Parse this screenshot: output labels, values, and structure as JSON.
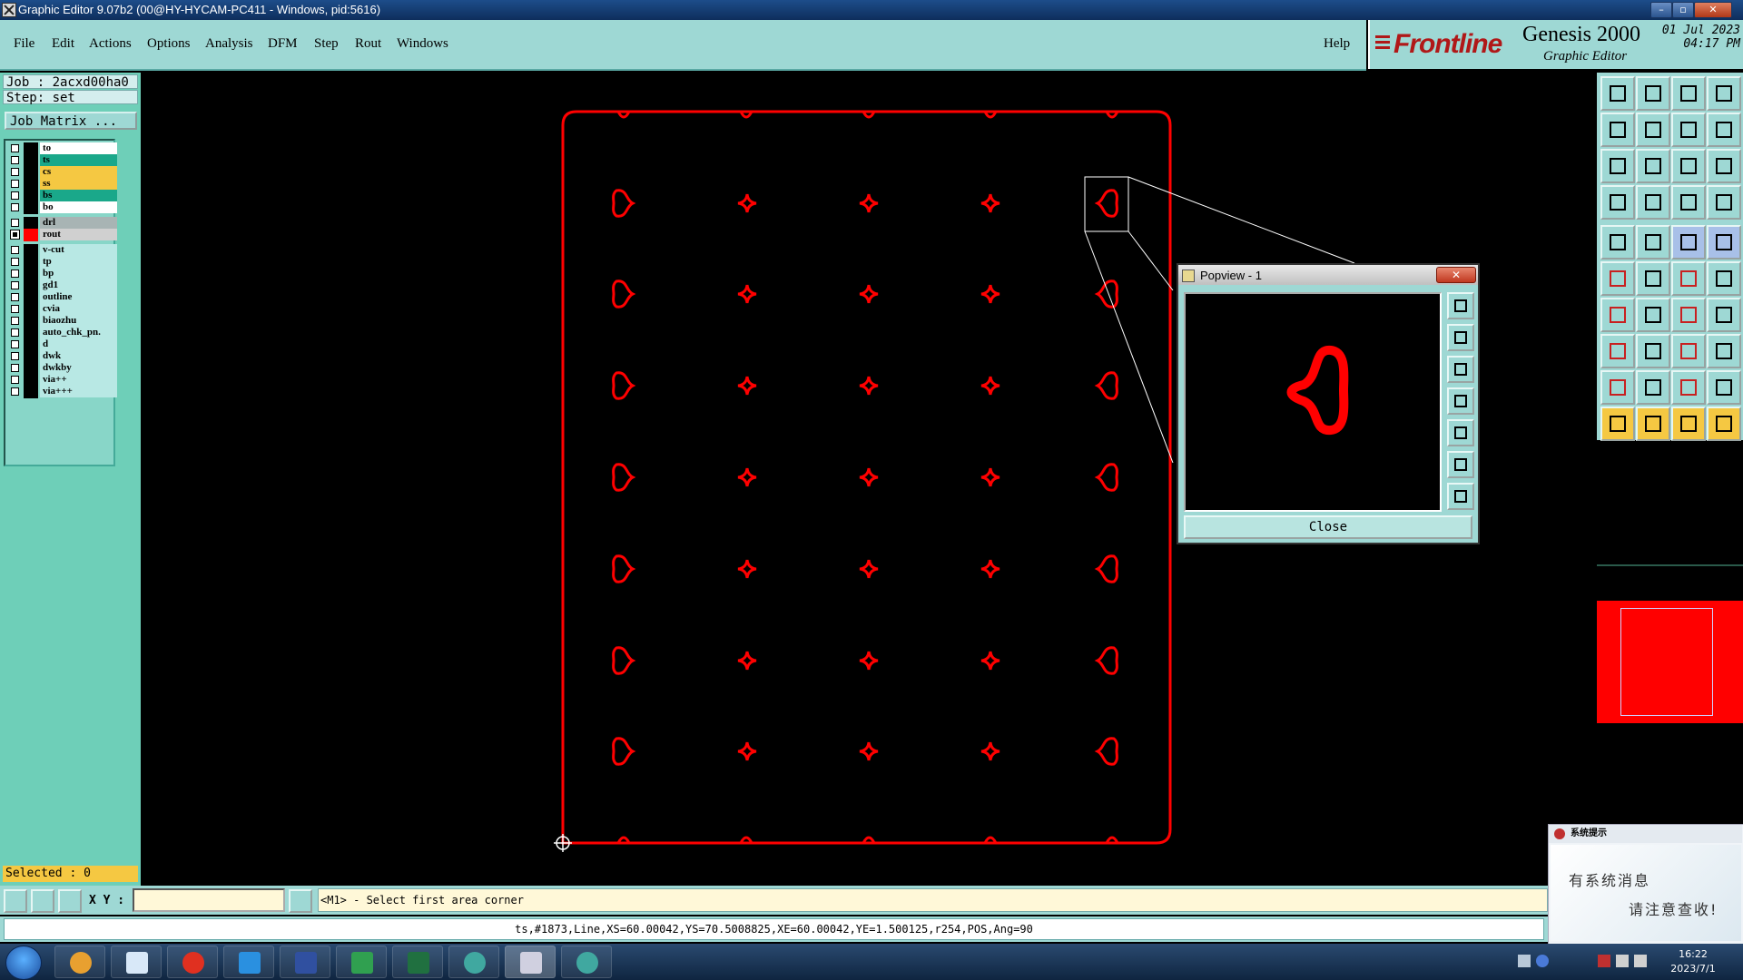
{
  "window": {
    "title": "Graphic Editor 9.07b2 (00@HY-HYCAM-PC411 - Windows, pid:5616)",
    "controls": [
      "–",
      "▫",
      "✕"
    ]
  },
  "menu": {
    "items": [
      "File",
      "Edit",
      "Actions",
      "Options",
      "Analysis",
      "DFM",
      "Step",
      "Rout",
      "Windows"
    ],
    "help": "Help"
  },
  "brand": {
    "logo": "Frontline",
    "product": "Genesis 2000",
    "subtitle": "Graphic Editor",
    "date": "01 Jul 2023",
    "time": "04:17 PM"
  },
  "job": {
    "job_line": "Job : 2acxd00ha0",
    "step_line": "Step: set",
    "matrix_button": "Job Matrix ..."
  },
  "layers": [
    {
      "name": "to",
      "bg": "#ffffff",
      "checked": false,
      "color": "#000000"
    },
    {
      "name": "ts",
      "bg": "#1aa88a",
      "checked": false,
      "color": "#000000"
    },
    {
      "name": "cs",
      "bg": "#f5c842",
      "checked": false,
      "color": "#000000"
    },
    {
      "name": "ss",
      "bg": "#f5c842",
      "checked": false,
      "color": "#000000"
    },
    {
      "name": "bs",
      "bg": "#1aa88a",
      "checked": false,
      "color": "#000000"
    },
    {
      "name": "bo",
      "bg": "#ffffff",
      "checked": false,
      "color": "#000000"
    },
    {
      "name": "drl",
      "bg": "#a8b4b4",
      "checked": false,
      "color": "#000000"
    },
    {
      "name": "rout",
      "bg": "#d0d0d0",
      "checked": true,
      "color": "#ff0000"
    },
    {
      "name": "v-cut",
      "bg": "#b8e8e4",
      "checked": false,
      "color": "#000000"
    },
    {
      "name": "tp",
      "bg": "#b8e8e4",
      "checked": false,
      "color": "#000000"
    },
    {
      "name": "bp",
      "bg": "#b8e8e4",
      "checked": false,
      "color": "#000000"
    },
    {
      "name": "gd1",
      "bg": "#b8e8e4",
      "checked": false,
      "color": "#000000"
    },
    {
      "name": "outline",
      "bg": "#b8e8e4",
      "checked": false,
      "color": "#000000"
    },
    {
      "name": "cvia",
      "bg": "#b8e8e4",
      "checked": false,
      "color": "#000000"
    },
    {
      "name": "biaozhu",
      "bg": "#b8e8e4",
      "checked": false,
      "color": "#000000"
    },
    {
      "name": "auto_chk_pn.",
      "bg": "#b8e8e4",
      "checked": false,
      "color": "#000000"
    },
    {
      "name": "d",
      "bg": "#b8e8e4",
      "checked": false,
      "color": "#000000"
    },
    {
      "name": "dwk",
      "bg": "#b8e8e4",
      "checked": false,
      "color": "#000000"
    },
    {
      "name": "dwkby",
      "bg": "#b8e8e4",
      "checked": false,
      "color": "#000000"
    },
    {
      "name": "via++",
      "bg": "#b8e8e4",
      "checked": false,
      "color": "#000000"
    },
    {
      "name": "via+++",
      "bg": "#b8e8e4",
      "checked": false,
      "color": "#000000"
    }
  ],
  "selected": "Selected : 0",
  "popview": {
    "title": "Popview - 1",
    "close_x": "✕",
    "close_button": "Close"
  },
  "command": {
    "xy_label": "X Y :",
    "xy_value": "",
    "message": "<M1> - Select first area corner"
  },
  "status": "ts,#1873,Line,XS=60.00042,YS=70.5008825,XE=60.00042,YE=1.500125,r254,POS,Ang=90",
  "notification": {
    "header": "系统提示",
    "line1": "有系统消息",
    "line2": "请注意查收!"
  },
  "taskbar": {
    "time": "16:22",
    "date": "2023/7/1"
  },
  "colors": {
    "panel": "#9ed8d4",
    "rout": "#ff0000",
    "canvas": "#000000"
  }
}
